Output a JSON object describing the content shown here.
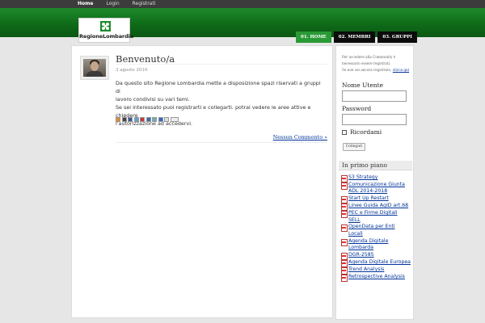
{
  "topbar": {
    "links": [
      "Home",
      "Login",
      "Registrati"
    ]
  },
  "header": {
    "logo_text": "RegioneLombardia",
    "nav": [
      "01. HOME",
      "02. MEMBRI",
      "03. GRUPPI"
    ]
  },
  "post": {
    "title": "Benvenuto/a",
    "date": "3 agosto 2016",
    "body_lines": [
      "Da questo sito Regione Lombardia mette a disposizione spazi riservati a gruppi di",
      "lavoro condivisi su vari temi.",
      "Se sei interessato puoi registrarti e collegarti. potrai vedere le aree attive e chiedere",
      "l'autorizzazione ad accedervi."
    ],
    "comments_link": "Nessun Commento »"
  },
  "login": {
    "note_lines": [
      "Per accedere alla Community è",
      "necessario essere registrati.",
      "Se non sei ancora registrato,"
    ],
    "note_link": "clicca qui",
    "username_label": "Nome Utente",
    "password_label": "Password",
    "remember_label": "Ricordami",
    "button_label": "Collegati"
  },
  "sidebar": {
    "widget_title": "In primo piano",
    "links": [
      "S3 Strategy",
      "Comunicazione Giunta ADL 2014-2018",
      "Start Up Restart",
      "Linee Guida AgID art.68",
      "PEC e Firme Digitali SELL",
      "OpenData per Enti Locali",
      "Agenda Digitale Lombarda",
      "DGR-2585",
      "Agenda Digitale Europea",
      "Trend Analysis",
      "Retrospective Analysis"
    ]
  },
  "colors": {
    "brand_green": "#1d8b2b",
    "nav_active": "#2a9a36",
    "link": "#003399"
  }
}
